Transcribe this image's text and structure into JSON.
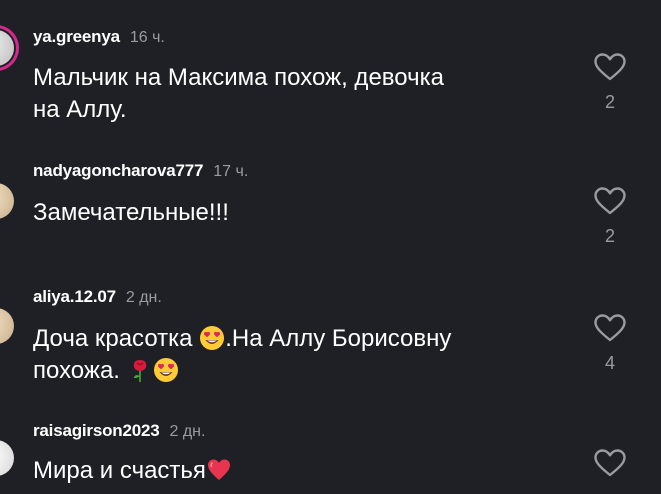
{
  "comments": [
    {
      "username": "ya.greenya",
      "time": "16 ч.",
      "text_line1": "Мальчик на Максима похож, девочка",
      "text_line2": "на Аллу.",
      "likes": "2"
    },
    {
      "username": "nadyagoncharova777",
      "time": "17 ч.",
      "text_line1": "Замечательные!!!",
      "likes": "2"
    },
    {
      "username": "aliya.12.07",
      "time": "2 дн.",
      "text_part1": "Доча красотка ",
      "text_part2": ".На Аллу Борисовну",
      "text_line2": "похожа. ",
      "likes": "4"
    },
    {
      "username": "raisagirson2023",
      "time": "2 дн.",
      "text_line1": "Мира и счастья"
    }
  ],
  "colors": {
    "background": "#1f2025",
    "secondary_text": "#9a9ba1",
    "story_ring": "#d22a8a"
  }
}
